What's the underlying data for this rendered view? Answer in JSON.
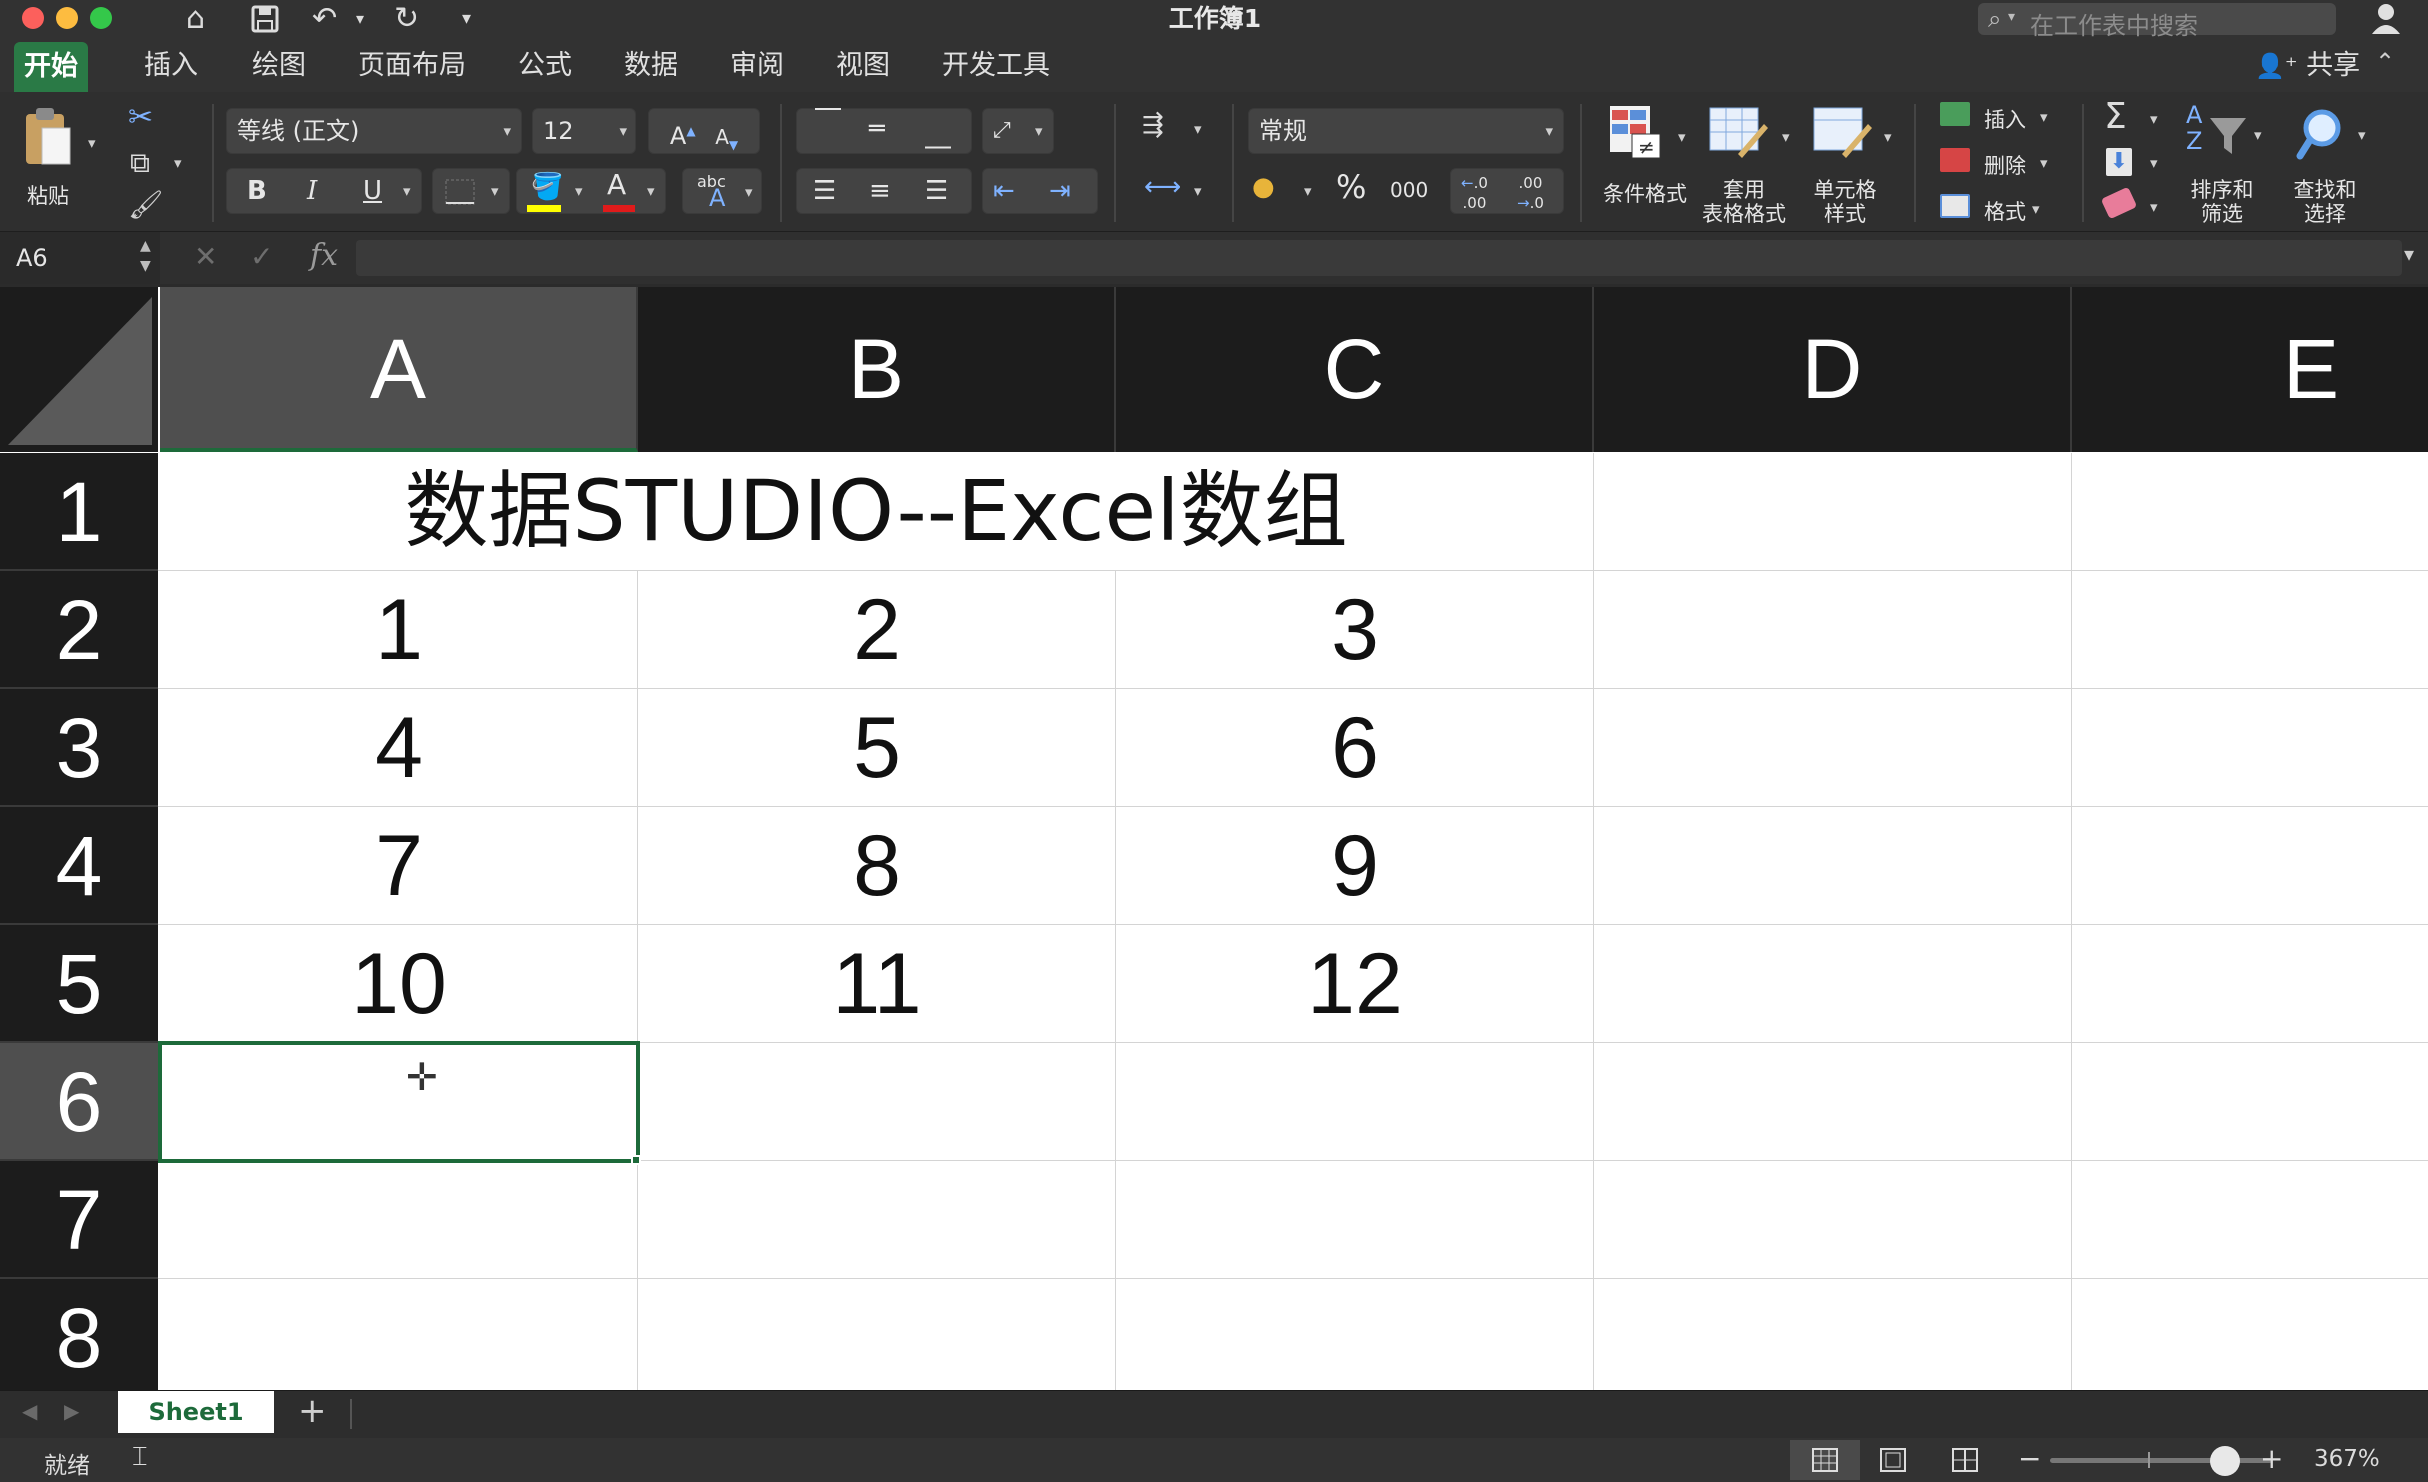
{
  "window": {
    "title": "工作簿1",
    "search_placeholder": "在工作表中搜索"
  },
  "tabs": [
    "开始",
    "插入",
    "绘图",
    "页面布局",
    "公式",
    "数据",
    "审阅",
    "视图",
    "开发工具"
  ],
  "share_label": "共享",
  "ribbon": {
    "paste_label": "粘贴",
    "font_name": "等线 (正文)",
    "font_size": "12",
    "number_format": "常规",
    "bold": "B",
    "italic": "I",
    "underline": "U",
    "percent": "%",
    "thousands": "000",
    "conditional_format": "条件格式",
    "table_format_line1": "套用",
    "table_format_line2": "表格格式",
    "cell_style_line1": "单元格",
    "cell_style_line2": "样式",
    "insert": "插入",
    "delete": "删除",
    "format": "格式",
    "sort_line1": "排序和",
    "sort_line2": "筛选",
    "find_line1": "查找和",
    "find_line2": "选择"
  },
  "formula_bar": {
    "name_box": "A6",
    "fx": "fx"
  },
  "columns": [
    "A",
    "B",
    "C",
    "D",
    "E"
  ],
  "rows": [
    "1",
    "2",
    "3",
    "4",
    "5",
    "6",
    "7",
    "8"
  ],
  "title_cell": "数据STUDIO--Excel数组",
  "cells": [
    [
      "1",
      "2",
      "3"
    ],
    [
      "4",
      "5",
      "6"
    ],
    [
      "7",
      "8",
      "9"
    ],
    [
      "10",
      "11",
      "12"
    ]
  ],
  "sheet": {
    "name": "Sheet1",
    "add": "+"
  },
  "status": {
    "ready": "就绪",
    "zoom": "367%"
  },
  "colors": {
    "accent_green": "#1d6a3a",
    "tab_active": "#2a7a46"
  }
}
